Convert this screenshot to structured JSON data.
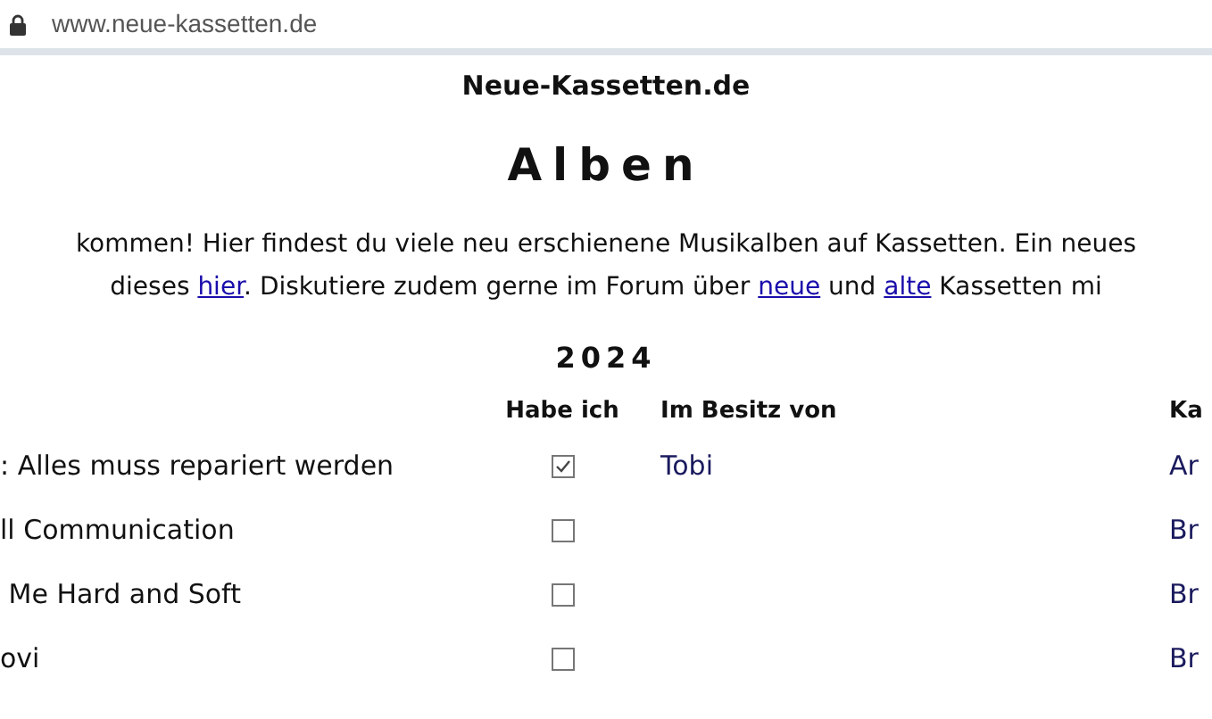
{
  "address_bar": {
    "url": "www.neue-kassetten.de"
  },
  "site_title": "Neue-Kassetten.de",
  "heading": "Alben",
  "intro": [
    [
      {
        "kind": "text",
        "text": "kommen! Hier findest du viele neu erschienene Musikalben auf Kassetten. Ein neues"
      }
    ],
    [
      {
        "kind": "text",
        "text": "dieses "
      },
      {
        "kind": "link",
        "text": "hier"
      },
      {
        "kind": "text",
        "text": ". Diskutiere zudem gerne im Forum über "
      },
      {
        "kind": "link",
        "text": "neue"
      },
      {
        "kind": "text",
        "text": " und "
      },
      {
        "kind": "link",
        "text": "alte"
      },
      {
        "kind": "text",
        "text": " Kassetten mi"
      }
    ]
  ],
  "year": "2024",
  "table": {
    "columns": [
      "Habe ich",
      "Im Besitz von",
      "Ka"
    ],
    "rows": [
      {
        "column_1": ": Alles muss repariert werden",
        "checked": true,
        "owner": "Tobi",
        "column_4": "Ar"
      },
      {
        "column_1": "ll Communication",
        "checked": false,
        "column_4": "Br"
      },
      {
        "column_1": " Me Hard and Soft",
        "checked": false,
        "column_4": "Br"
      },
      {
        "column_1": "ovi",
        "checked": false,
        "column_4": "Br"
      }
    ]
  }
}
